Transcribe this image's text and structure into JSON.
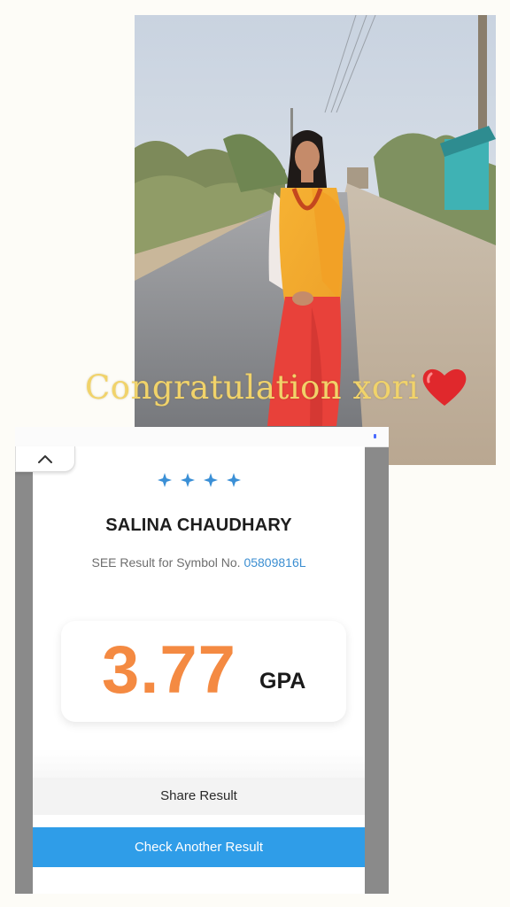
{
  "overlay": {
    "caption": "Congratulation xori",
    "heart_icon": "red-heart-icon",
    "caption_color": "#f1d36a"
  },
  "result": {
    "student_name": "SALINA CHAUDHARY",
    "symbol_prefix": "SEE Result for Symbol No.",
    "symbol_no": "05809816L",
    "gpa_value": "3.77",
    "gpa_label": "GPA",
    "star_icon": "sparkle-star-icon",
    "star_count": 4,
    "collapse_icon": "chevron-up-icon"
  },
  "actions": {
    "share_label": "Share Result",
    "check_another_label": "Check Another Result"
  },
  "colors": {
    "accent_blue": "#2f9de8",
    "gpa_orange": "#f48a42",
    "symbol_blue": "#3b8ed1"
  }
}
